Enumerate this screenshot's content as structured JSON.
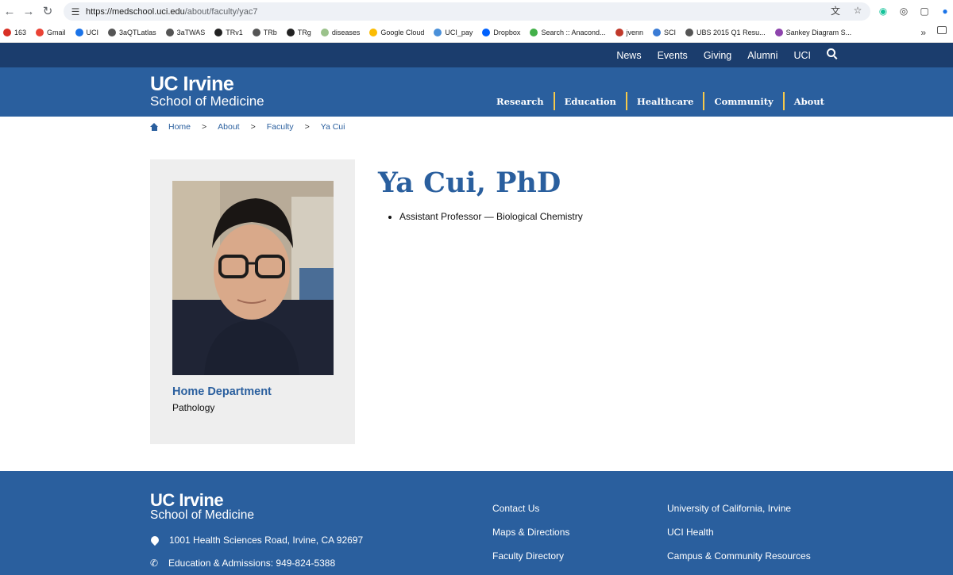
{
  "browser": {
    "url_host": "https://medschool.uci.edu",
    "url_path": "/about/faculty/yac7",
    "bookmarks": [
      {
        "label": "163",
        "color": "#d93025"
      },
      {
        "label": "Gmail",
        "color": "#ea4335"
      },
      {
        "label": "UCI",
        "color": "#1a73e8"
      },
      {
        "label": "3aQTLatlas",
        "color": "#555555"
      },
      {
        "label": "3aTWAS",
        "color": "#555555"
      },
      {
        "label": "TRv1",
        "color": "#222222"
      },
      {
        "label": "TRb",
        "color": "#555555"
      },
      {
        "label": "TRg",
        "color": "#222222"
      },
      {
        "label": "diseases",
        "color": "#9bc28b"
      },
      {
        "label": "Google Cloud",
        "color": "#fbbc04"
      },
      {
        "label": "UCI_pay",
        "color": "#4a90d9"
      },
      {
        "label": "Dropbox",
        "color": "#0061fe"
      },
      {
        "label": "Search :: Anacond...",
        "color": "#43b049"
      },
      {
        "label": "jvenn",
        "color": "#c0392b"
      },
      {
        "label": "SCI",
        "color": "#3a7bd5"
      },
      {
        "label": "UBS 2015 Q1 Resu...",
        "color": "#555555"
      },
      {
        "label": "Sankey Diagram S...",
        "color": "#8e44ad"
      }
    ]
  },
  "site": {
    "top_links": [
      "News",
      "Events",
      "Giving",
      "Alumni",
      "UCI"
    ],
    "logo_line1": "UC Irvine",
    "logo_line2": "School of Medicine",
    "main_nav": [
      "Research",
      "Education",
      "Healthcare",
      "Community",
      "About"
    ],
    "colors": {
      "dark_blue": "#1b3d6d",
      "blue": "#2a5f9e",
      "gold": "#f6c94a"
    }
  },
  "breadcrumb": {
    "items": [
      "Home",
      "About",
      "Faculty",
      "Ya Cui"
    ],
    "separator": ">"
  },
  "profile": {
    "name": "Ya Cui, PhD",
    "titles": [
      "Assistant Professor — Biological Chemistry"
    ],
    "dept_label": "Home Department",
    "dept_value": "Pathology"
  },
  "footer": {
    "logo_line1": "UC Irvine",
    "logo_line2": "School of Medicine",
    "address": "1001 Health Sciences Road, Irvine, CA 92697",
    "phone": "Education & Admissions: 949-824-5388",
    "col1": [
      "Contact Us",
      "Maps & Directions",
      "Faculty Directory"
    ],
    "col2": [
      "University of California, Irvine",
      "UCI Health",
      "Campus & Community Resources"
    ]
  }
}
